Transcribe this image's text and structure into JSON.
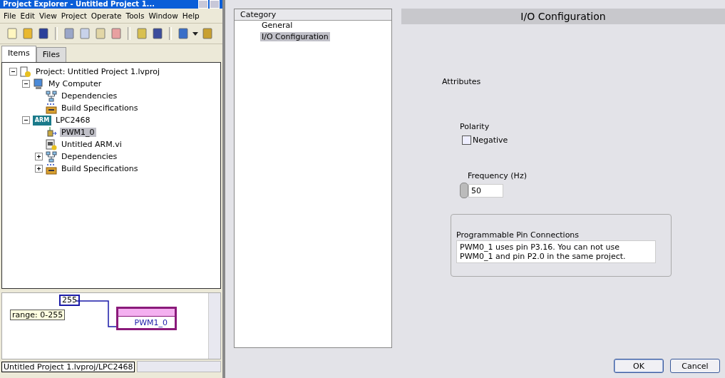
{
  "window": {
    "title": "Project Explorer - Untitled Project 1..."
  },
  "menu": [
    "File",
    "Edit",
    "View",
    "Project",
    "Operate",
    "Tools",
    "Window",
    "Help"
  ],
  "tabs": [
    {
      "label": "Items",
      "selected": true
    },
    {
      "label": "Files",
      "selected": false
    }
  ],
  "tree": [
    {
      "label": "Project: Untitled Project 1.lvproj",
      "kind": "project",
      "expanded": true,
      "selected": false,
      "children": [
        {
          "label": "My Computer",
          "kind": "computer",
          "expanded": true,
          "selected": false,
          "children": [
            {
              "label": "Dependencies",
              "kind": "dependencies",
              "selected": false
            },
            {
              "label": "Build Specifications",
              "kind": "build",
              "selected": false
            }
          ]
        },
        {
          "label": "LPC2468",
          "kind": "arm",
          "icon_label": "ARM",
          "expanded": true,
          "selected": false,
          "children": [
            {
              "label": "PWM1_0",
              "kind": "io",
              "selected": true
            },
            {
              "label": "Untitled ARM.vi",
              "kind": "vi",
              "selected": false
            },
            {
              "label": "Dependencies",
              "kind": "dependencies",
              "expanded": false,
              "selected": false
            },
            {
              "label": "Build Specifications",
              "kind": "build",
              "expanded": false,
              "selected": false
            }
          ]
        }
      ]
    }
  ],
  "diagram": {
    "constant": "255",
    "tip": "range: 0-255",
    "node": "PWM1_0"
  },
  "status_bar": {
    "path": "Untitled Project 1.lvproj/LPC2468"
  },
  "category": {
    "header": "Category",
    "items": [
      {
        "label": "General",
        "selected": false
      },
      {
        "label": "I/O Configuration",
        "selected": true
      }
    ]
  },
  "page": {
    "title": "I/O Configuration",
    "section": "Attributes",
    "polarity": {
      "label": "Polarity",
      "option": "Negative",
      "checked": false
    },
    "frequency": {
      "label": "Frequency (Hz)",
      "value": "50"
    },
    "pins": {
      "label": "Programmable Pin Connections",
      "text": "PWM0_1 uses pin P3.16. You can not use PWM0_1 and pin P2.0 in the same project."
    }
  },
  "buttons": [
    {
      "label": "OK",
      "default": true
    },
    {
      "label": "Cancel",
      "default": false
    }
  ]
}
